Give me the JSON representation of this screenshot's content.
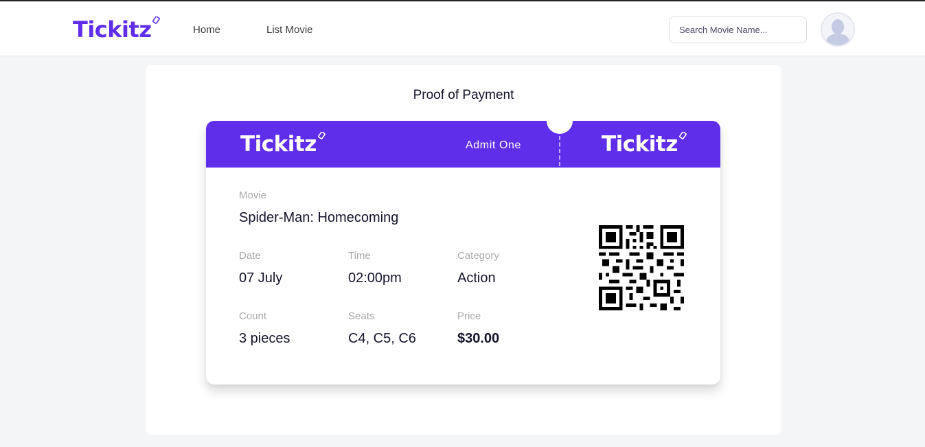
{
  "header": {
    "logo": "Tickitz",
    "nav": [
      {
        "label": "Home"
      },
      {
        "label": "List Movie"
      }
    ],
    "search": {
      "placeholder": "Search Movie Name...",
      "value": ""
    }
  },
  "card": {
    "title": "Proof of Payment"
  },
  "ticket": {
    "logo_left": "Tickitz",
    "admit_text": "Admit One",
    "logo_right": "Tickitz",
    "movie": {
      "label": "Movie",
      "value": "Spider-Man: Homecoming"
    },
    "date": {
      "label": "Date",
      "value": "07 July"
    },
    "time": {
      "label": "Time",
      "value": "02:00pm"
    },
    "category": {
      "label": "Category",
      "value": "Action"
    },
    "count": {
      "label": "Count",
      "value": "3 pieces"
    },
    "seats": {
      "label": "Seats",
      "value": "C4, C5, C6"
    },
    "price": {
      "label": "Price",
      "value": "$30.00"
    }
  },
  "colors": {
    "brand": "#5f2eea",
    "background": "#f4f5f7",
    "text": "#14142b",
    "label": "#aaaaaa"
  },
  "icons": {
    "avatar": "user-silhouette-icon",
    "ticket_tag": "ticket-tag-icon",
    "qr": "qr-code-icon"
  }
}
